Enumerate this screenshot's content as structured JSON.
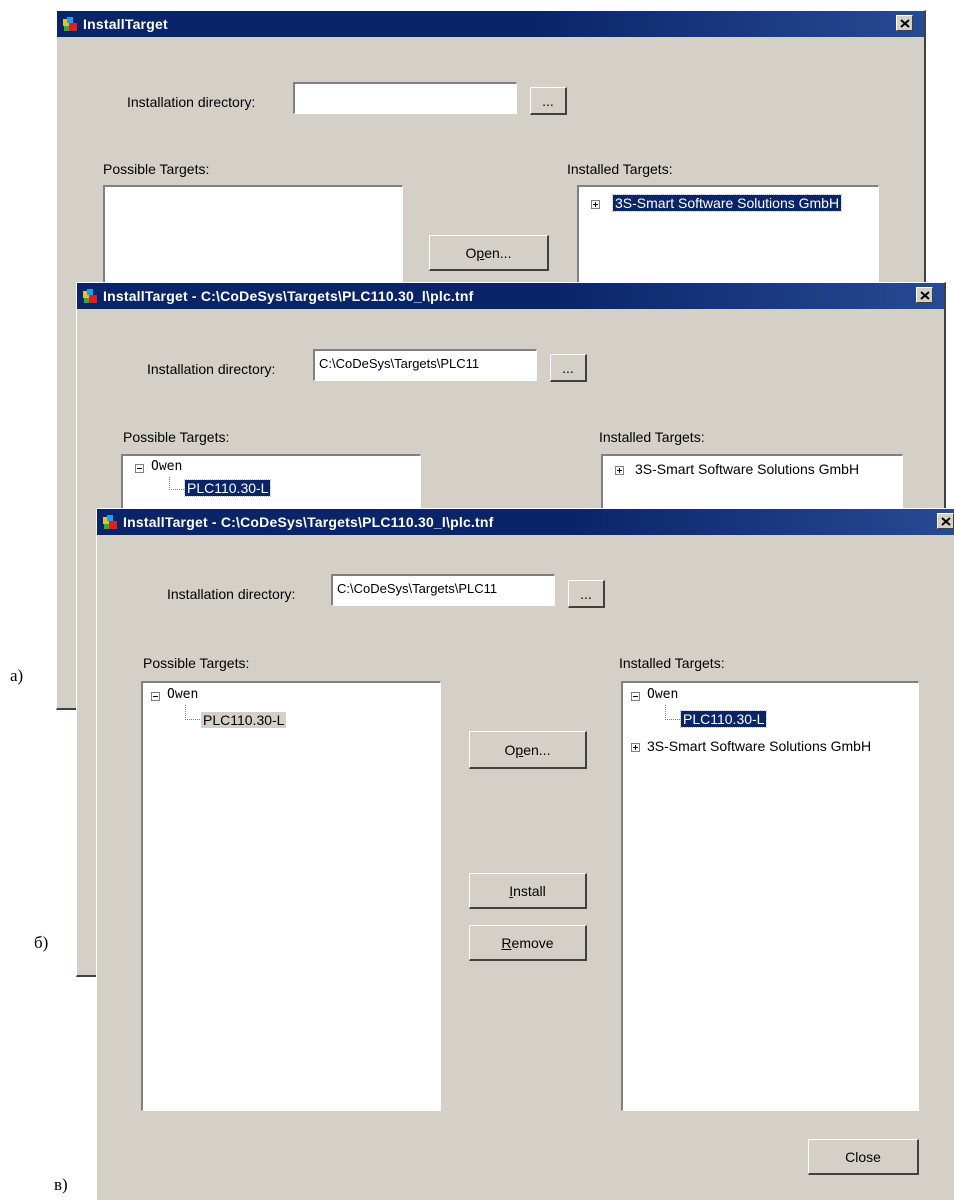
{
  "captions": {
    "a": "а)",
    "b": "б)",
    "c": "в)"
  },
  "dialog_a": {
    "title": "InstallTarget",
    "install_dir_label": "Installation directory:",
    "install_dir_value": "",
    "browse_label": "...",
    "possible_label": "Possible Targets:",
    "installed_label": "Installed Targets:",
    "open_label_pre": "O",
    "open_label_mn": "p",
    "open_label_post": "en...",
    "installed_items": [
      "3S-Smart Software Solutions GmbH"
    ]
  },
  "dialog_b": {
    "title": "InstallTarget - C:\\CoDeSys\\Targets\\PLC110.30_l\\plc.tnf",
    "install_dir_label": "Installation directory:",
    "install_dir_value": "C:\\CoDeSys\\Targets\\PLC11",
    "browse_label": "...",
    "possible_label": "Possible Targets:",
    "installed_label": "Installed Targets:",
    "possible_tree": {
      "parent": "Owen",
      "child": "PLC110.30-L"
    },
    "installed_items": [
      "3S-Smart Software Solutions GmbH"
    ]
  },
  "dialog_c": {
    "title": "InstallTarget - C:\\CoDeSys\\Targets\\PLC110.30_l\\plc.tnf",
    "install_dir_label": "Installation directory:",
    "install_dir_value": "C:\\CoDeSys\\Targets\\PLC11",
    "browse_label": "...",
    "possible_label": "Possible Targets:",
    "installed_label": "Installed Targets:",
    "possible_tree": {
      "parent": "Owen",
      "child": "PLC110.30-L"
    },
    "installed_tree": {
      "parent": "Owen",
      "child": "PLC110.30-L",
      "other": "3S-Smart Software Solutions GmbH"
    },
    "open_label_pre": "O",
    "open_label_mn": "p",
    "open_label_post": "en...",
    "install_label_mn": "I",
    "install_label_post": "nstall",
    "remove_label_mn": "R",
    "remove_label_post": "emove",
    "close_label": "Close"
  },
  "colors": {
    "title_bar": "#0a246a",
    "dialog_face": "#d4d0c8",
    "selection": "#0a246a"
  },
  "icons": {
    "app": "install-target-icon",
    "close": "close-x-icon"
  }
}
